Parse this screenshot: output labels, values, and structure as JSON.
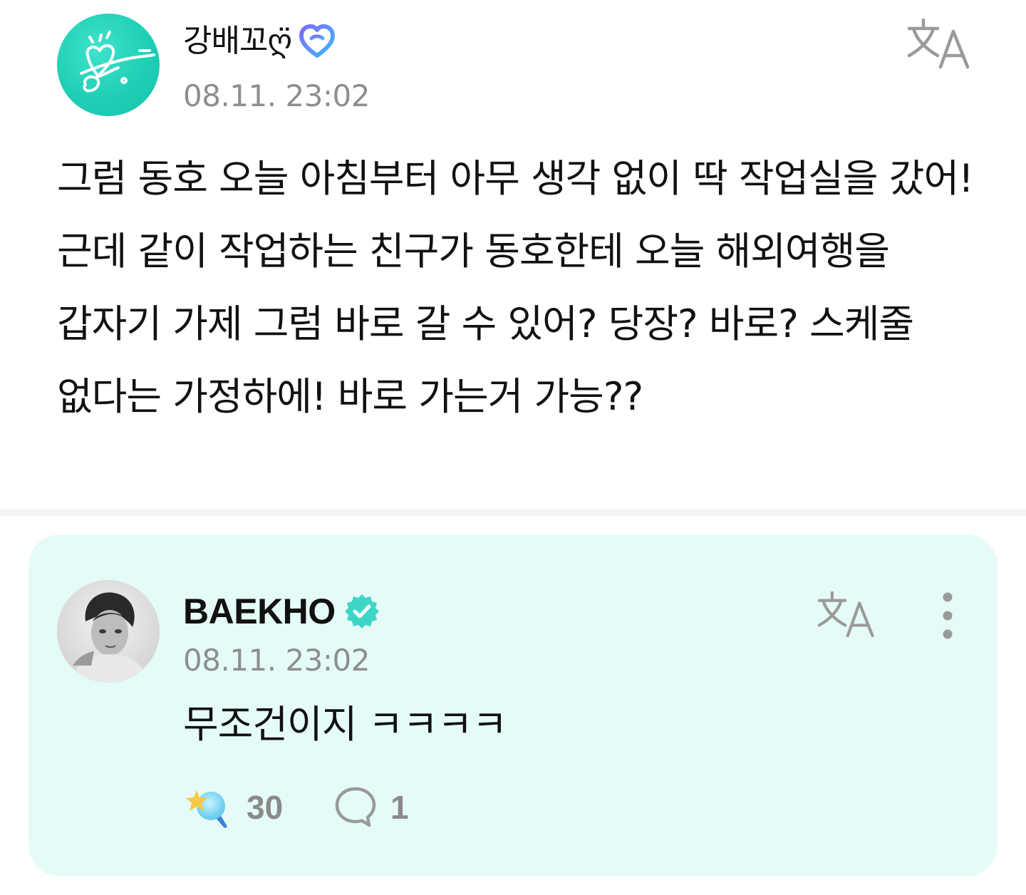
{
  "post": {
    "author_name": "강배꼬ღ̈",
    "author_badge_icon": "fan-heart-badge-icon",
    "timestamp": "08.11. 23:02",
    "body": "그럼 동호 오늘 아침부터 아무 생각 없이 딱 작업실을 갔어! 근데 같이 작업하는 친구가 동호한테 오늘 해외여행을 갑자기 가제 그럼 바로 갈 수 있어? 당장? 바로? 스케줄 없다는 가정하에! 바로 가는거 가능??",
    "translate_icon": "translate-icon"
  },
  "comment": {
    "author_name": "BAEKHO",
    "verified_icon": "verified-badge-icon",
    "timestamp": "08.11. 23:02",
    "body": "무조건이지 ㅋㅋㅋㅋ",
    "translate_icon": "translate-icon",
    "more_icon": "more-vertical-icon",
    "reaction_count": "30",
    "reply_count": "1"
  },
  "colors": {
    "card_background": "#e5fbf7",
    "avatar_teal": "#1fcfb5",
    "verified_teal": "#3dd6c6",
    "timestamp_gray": "#8e8e8e",
    "badge_gradient_start": "#7b6cff",
    "badge_gradient_end": "#3fb8ff"
  }
}
